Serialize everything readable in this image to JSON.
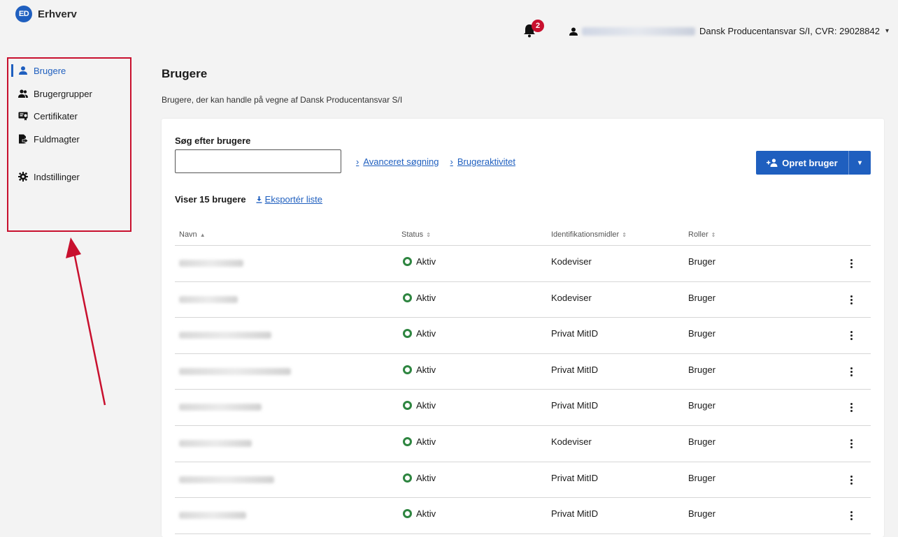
{
  "app": {
    "logo_badge": "ED",
    "logo_text": "Erhverv"
  },
  "header": {
    "notifications_count": "2",
    "org_label": "Dansk Producentansvar S/I, CVR: 29028842"
  },
  "sidebar": {
    "items": [
      {
        "label": "Brugere",
        "icon": "user-icon",
        "active": true
      },
      {
        "label": "Brugergrupper",
        "icon": "users-icon"
      },
      {
        "label": "Certifikater",
        "icon": "certificate-icon"
      },
      {
        "label": "Fuldmagter",
        "icon": "proxy-document-icon"
      },
      {
        "label": "Indstillinger",
        "icon": "gear-icon"
      }
    ]
  },
  "main": {
    "title": "Brugere",
    "subtitle": "Brugere, der kan handle på vegne af Dansk Producentansvar S/I",
    "search": {
      "label": "Søg efter brugere",
      "value": "",
      "placeholder": ""
    },
    "links": {
      "advanced": "Avanceret søgning",
      "activity": "Brugeraktivitet"
    },
    "create_button": "Opret bruger",
    "count_text": "Viser 15 brugere",
    "export_label": "Eksportér liste",
    "table": {
      "columns": [
        "Navn",
        "Status",
        "Identifikationsmidler",
        "Roller"
      ],
      "rows": [
        {
          "status": "Aktiv",
          "id_method": "Kodeviser",
          "role": "Bruger"
        },
        {
          "status": "Aktiv",
          "id_method": "Kodeviser",
          "role": "Bruger"
        },
        {
          "status": "Aktiv",
          "id_method": "Privat MitID",
          "role": "Bruger"
        },
        {
          "status": "Aktiv",
          "id_method": "Privat MitID",
          "role": "Bruger"
        },
        {
          "status": "Aktiv",
          "id_method": "Privat MitID",
          "role": "Bruger"
        },
        {
          "status": "Aktiv",
          "id_method": "Kodeviser",
          "role": "Bruger"
        },
        {
          "status": "Aktiv",
          "id_method": "Privat MitID",
          "role": "Bruger"
        },
        {
          "status": "Aktiv",
          "id_method": "Privat MitID",
          "role": "Bruger"
        }
      ]
    }
  },
  "colors": {
    "accent": "#1f5fbf",
    "highlight": "#c8102e",
    "status_active": "#2e8540"
  }
}
